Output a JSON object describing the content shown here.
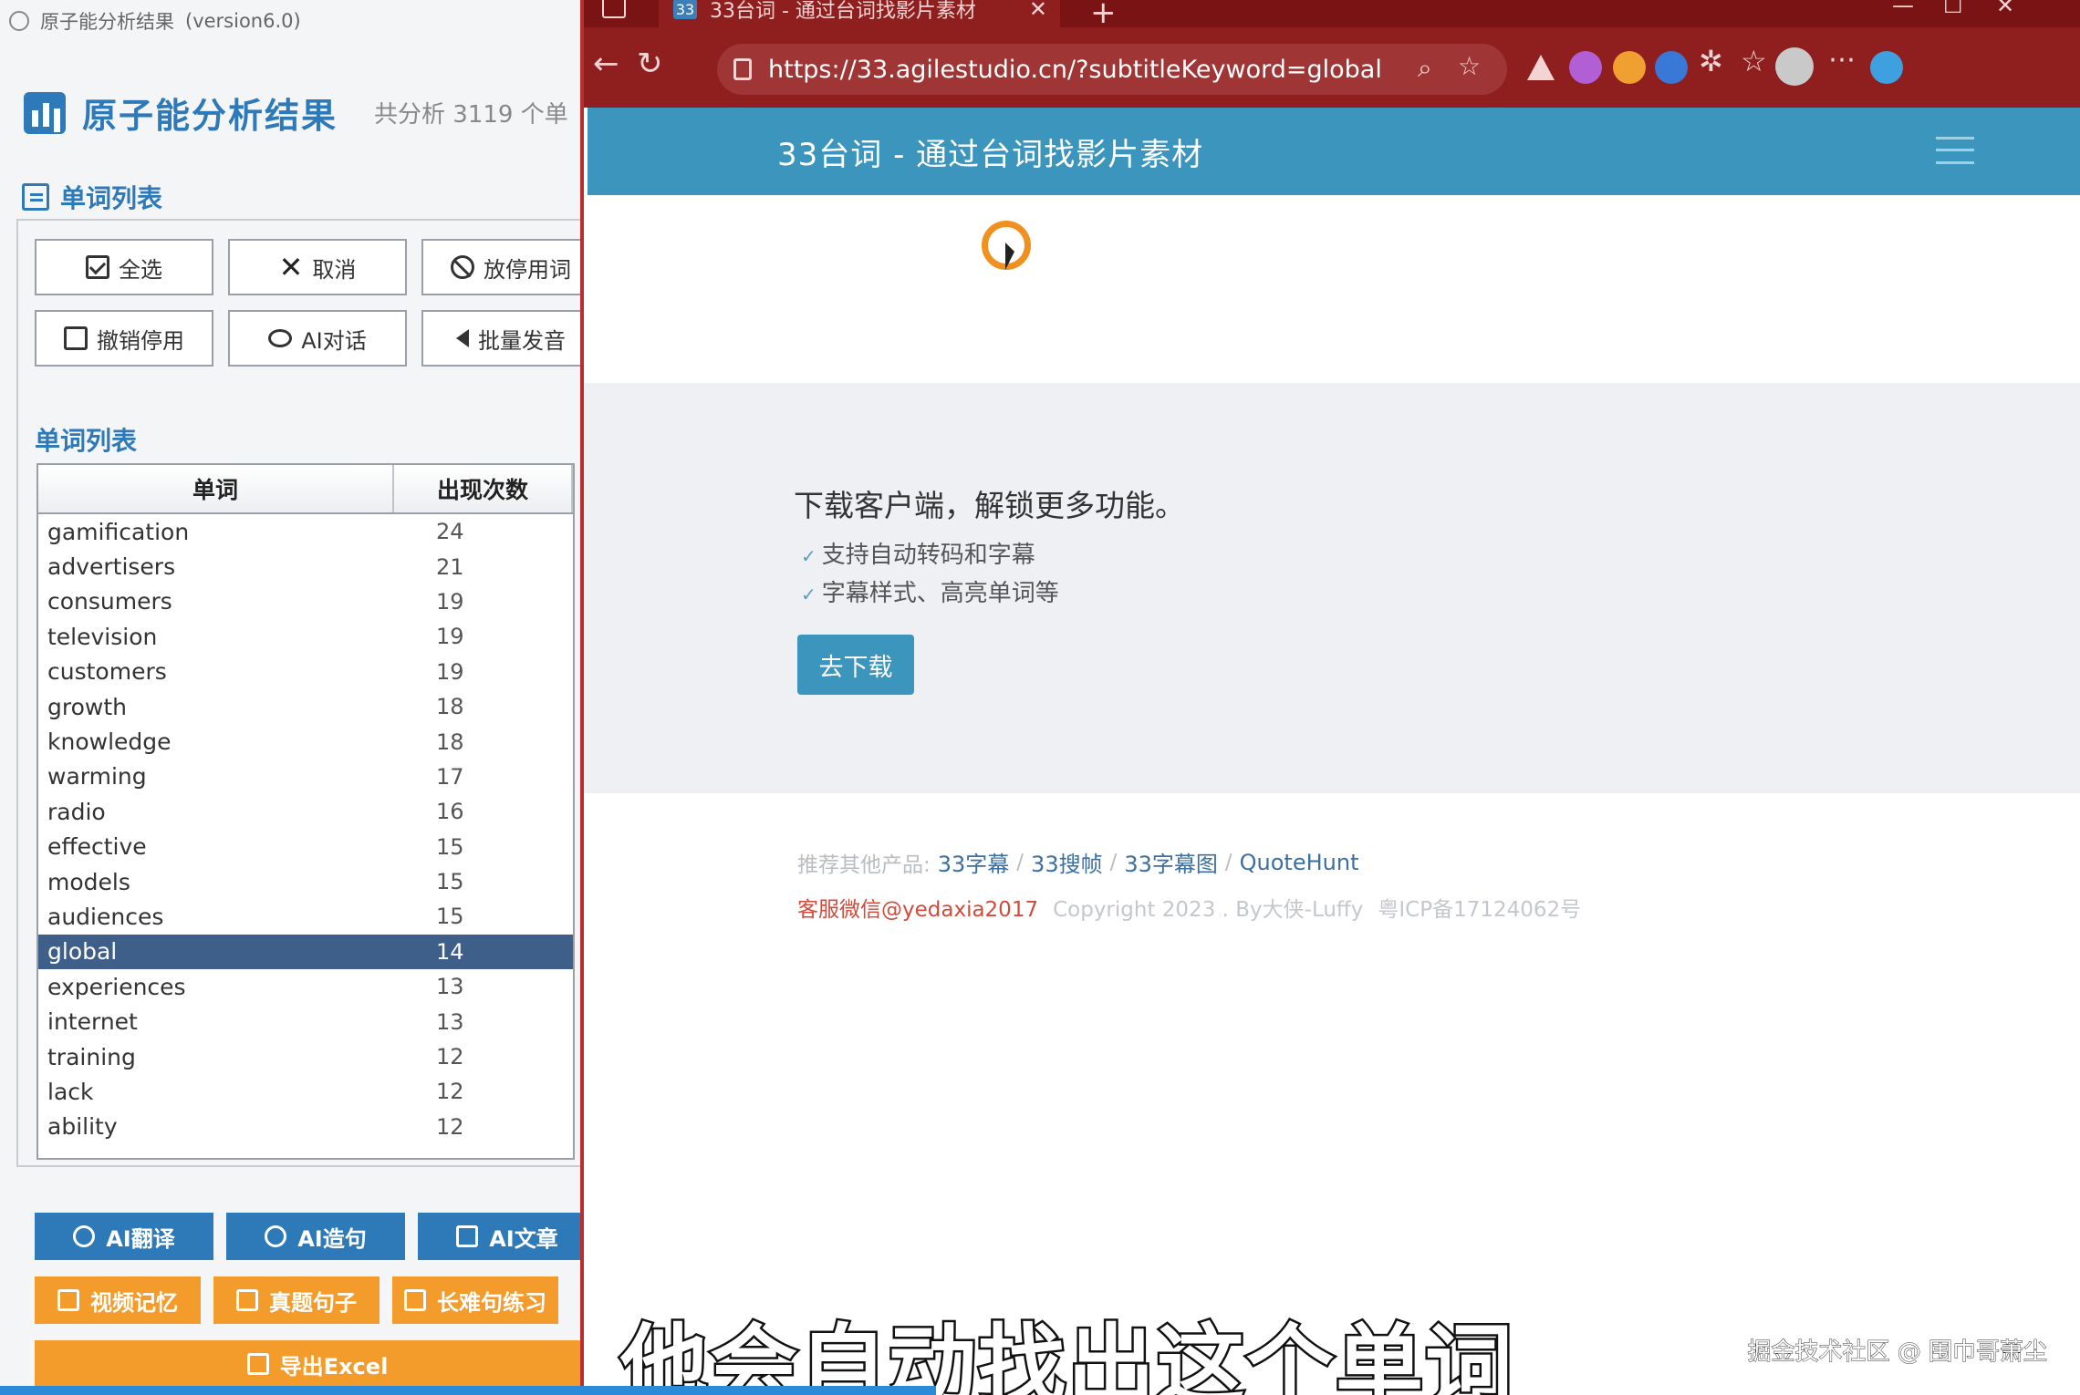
{
  "left_app": {
    "window_title": "原子能分析结果",
    "window_version": "(version6.0)",
    "title": "原子能分析结果",
    "subtitle": "共分析 3119 个单",
    "section_title": "单词列表",
    "buttons": {
      "select_all": "全选",
      "cancel": "取消",
      "stopword": "放停用词",
      "undo_stop": "撤销停用",
      "ai_chat": "AI对话",
      "batch_pronounce": "批量发音"
    },
    "list_title": "单词列表",
    "table": {
      "col_word": "单词",
      "col_count": "出现次数",
      "rows": [
        {
          "word": "gamification",
          "count": "24"
        },
        {
          "word": "advertisers",
          "count": "21"
        },
        {
          "word": "consumers",
          "count": "19"
        },
        {
          "word": "television",
          "count": "19"
        },
        {
          "word": "customers",
          "count": "19"
        },
        {
          "word": "growth",
          "count": "18"
        },
        {
          "word": "knowledge",
          "count": "18"
        },
        {
          "word": "warming",
          "count": "17"
        },
        {
          "word": "radio",
          "count": "16"
        },
        {
          "word": "effective",
          "count": "15"
        },
        {
          "word": "models",
          "count": "15"
        },
        {
          "word": "audiences",
          "count": "15"
        },
        {
          "word": "global",
          "count": "14"
        },
        {
          "word": "experiences",
          "count": "13"
        },
        {
          "word": "internet",
          "count": "13"
        },
        {
          "word": "training",
          "count": "12"
        },
        {
          "word": "lack",
          "count": "12"
        },
        {
          "word": "ability",
          "count": "12"
        }
      ],
      "selected_word": "global"
    },
    "bottom_buttons": {
      "ai_translate": "AI翻译",
      "ai_sentence": "AI造句",
      "ai_article": "AI文章",
      "video_memory": "视频记忆",
      "real_sentence": "真题句子",
      "long_sentence": "长难句练习",
      "export_excel": "导出Excel"
    }
  },
  "browser": {
    "tab_favicon": "33",
    "tab_title": "33台词 - 通过台词找影片素材",
    "url": "https://33.agilestudio.cn/?subtitleKeyword=global",
    "site_title": "33台词 - 通过台词找影片素材",
    "promo": {
      "title": "下载客户端，解锁更多功能。",
      "item1": "支持自动转码和字幕",
      "item2": "字幕样式、高亮单词等",
      "button": "去下载"
    },
    "footer": {
      "recommend_label": "推荐其他产品:",
      "links": [
        "33字幕",
        "33搜帧",
        "33字幕图",
        "QuoteHunt"
      ],
      "service": "客服微信@yedaxia2017",
      "copyright": "Copyright 2023 . By大侠-Luffy",
      "icp": "粤ICP备17124062号"
    }
  },
  "overlay": {
    "subtitle": "他会自动找出这个单词",
    "watermark": "掘金技术社区 @ 围巾哥萧尘"
  },
  "colors": {
    "app_blue": "#2e79b8",
    "app_orange": "#f39c2b",
    "browser_chrome": "#8f1f1f",
    "site_header": "#3b95bd",
    "selection": "#3e5f8a"
  }
}
